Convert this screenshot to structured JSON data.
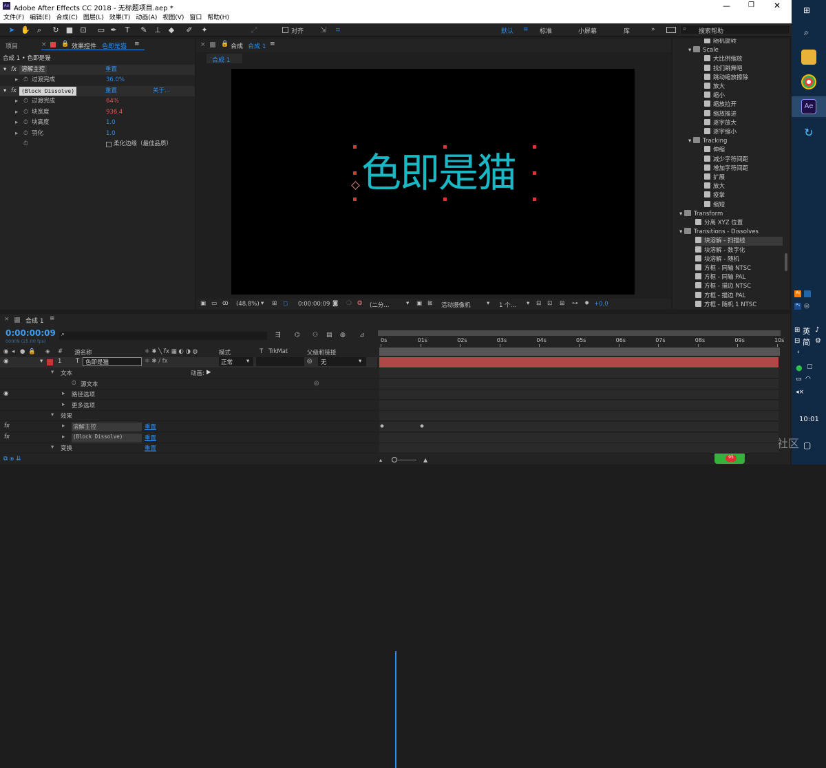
{
  "window": {
    "title": "Adobe After Effects CC 2018 - 无标题项目.aep *",
    "app_icon": "Ae"
  },
  "menu": [
    "文件(F)",
    "编辑(E)",
    "合成(C)",
    "图层(L)",
    "效果(T)",
    "动画(A)",
    "视图(V)",
    "窗口",
    "帮助(H)"
  ],
  "toolbar": {
    "align_label": "对齐",
    "workspaces": [
      "默认",
      "标准",
      "小屏幕",
      "库"
    ],
    "search_placeholder": "搜索帮助"
  },
  "effects_panel": {
    "tab_project": "项目",
    "tab_effects": "效果控件",
    "layer_name": "色即是猫",
    "breadcrumb": "合成 1 • 色即是猫",
    "effects": [
      {
        "name": "溶解主控",
        "reset": "重置",
        "props": [
          {
            "label": "过渡完成",
            "value": "36.0%"
          }
        ]
      },
      {
        "name": "(Block Dissolve)",
        "reset": "重置",
        "about": "关于...",
        "props": [
          {
            "label": "过渡完成",
            "value": "64%"
          },
          {
            "label": "块宽度",
            "value": "936.4"
          },
          {
            "label": "块高度",
            "value": "1.0"
          },
          {
            "label": "羽化",
            "value": "1.0"
          }
        ],
        "checkbox_label": "柔化边缘（最佳品质）"
      }
    ]
  },
  "composition": {
    "tab": "合成",
    "name": "合成 1",
    "subtab": "合成 1",
    "text": "色即是猫",
    "text_color": "#1ab8c4",
    "zoom": "(48.8%)",
    "timecode": "0:00:00:09",
    "resolution": "(二分...",
    "camera": "活动摄像机",
    "views": "1 个...",
    "exposure": "+0.0"
  },
  "effects_presets": {
    "items": [
      {
        "label": "随机旋转",
        "folder": false,
        "indent": 2
      },
      {
        "label": "Scale",
        "folder": true,
        "indent": 1
      },
      {
        "label": "大比例缩放",
        "folder": false,
        "indent": 2
      },
      {
        "label": "找们跳舞吧",
        "folder": false,
        "indent": 2
      },
      {
        "label": "跳动缩放擦除",
        "folder": false,
        "indent": 2
      },
      {
        "label": "放大",
        "folder": false,
        "indent": 2
      },
      {
        "label": "缩小",
        "folder": false,
        "indent": 2
      },
      {
        "label": "缩放拉开",
        "folder": false,
        "indent": 2
      },
      {
        "label": "缩放推进",
        "folder": false,
        "indent": 2
      },
      {
        "label": "逐字放大",
        "folder": false,
        "indent": 2
      },
      {
        "label": "逐字缩小",
        "folder": false,
        "indent": 2
      },
      {
        "label": "Tracking",
        "folder": true,
        "indent": 1
      },
      {
        "label": "伸缩",
        "folder": false,
        "indent": 2
      },
      {
        "label": "减少字符间距",
        "folder": false,
        "indent": 2
      },
      {
        "label": "增加字符间距",
        "folder": false,
        "indent": 2
      },
      {
        "label": "扩展",
        "folder": false,
        "indent": 2
      },
      {
        "label": "放大",
        "folder": false,
        "indent": 2
      },
      {
        "label": "疫掌",
        "folder": false,
        "indent": 2
      },
      {
        "label": "缩短",
        "folder": false,
        "indent": 2
      },
      {
        "label": "Transform",
        "folder": true,
        "indent": 0
      },
      {
        "label": "分离 XYZ 位置",
        "folder": false,
        "indent": 1
      },
      {
        "label": "Transitions - Dissolves",
        "folder": true,
        "indent": 0
      },
      {
        "label": "块溶解 - 扫描线",
        "folder": false,
        "indent": 1,
        "selected": true
      },
      {
        "label": "块溶解 - 数字化",
        "folder": false,
        "indent": 1
      },
      {
        "label": "块溶解 - 随机",
        "folder": false,
        "indent": 1
      },
      {
        "label": "方框 - 同轴 NTSC",
        "folder": false,
        "indent": 1
      },
      {
        "label": "方框 - 同轴 PAL",
        "folder": false,
        "indent": 1
      },
      {
        "label": "方框 - 描边 NTSC",
        "folder": false,
        "indent": 1
      },
      {
        "label": "方框 - 描边 PAL",
        "folder": false,
        "indent": 1
      },
      {
        "label": "方框 - 随机 1 NTSC",
        "folder": false,
        "indent": 1
      }
    ]
  },
  "timeline": {
    "tab": "合成 1",
    "timecode": "0:00:00:09",
    "fps": "00009 (25.00 fps)",
    "columns": {
      "source": "源名称",
      "mode": "模式",
      "t": "T",
      "trkmat": "TrkMat",
      "parent": "父级和链接"
    },
    "layer": {
      "index": "1",
      "type": "T",
      "name": "色即是猫",
      "mode": "正常",
      "parent": "无"
    },
    "rows": [
      {
        "label": "文本",
        "level": 1,
        "extra": "动画:"
      },
      {
        "label": "源文本",
        "level": 2
      },
      {
        "label": "路径选项",
        "level": 2
      },
      {
        "label": "更多选项",
        "level": 2
      },
      {
        "label": "效果",
        "level": 1
      },
      {
        "label": "溶解主控",
        "level": 2,
        "reset": "重置"
      },
      {
        "label": "(Block Dissolve)",
        "level": 2,
        "reset": "重置"
      },
      {
        "label": "变换",
        "level": 1,
        "reset": "重置"
      }
    ],
    "ruler": [
      "0s",
      "01s",
      "02s",
      "03s",
      "04s",
      "05s",
      "06s",
      "07s",
      "08s",
      "09s",
      "10s"
    ],
    "playhead_seconds": 0.36,
    "bar_color": "#b24747"
  },
  "taskbar": {
    "ime": "英",
    "ime2": "简",
    "clock": "10:01",
    "watermark": "@稀土掘金技术社区"
  }
}
